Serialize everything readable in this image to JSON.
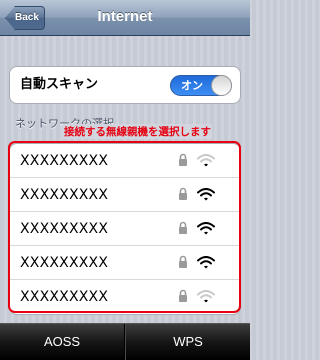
{
  "navbar": {
    "back_label": "Back",
    "title": "Internet"
  },
  "scan": {
    "label": "自動スキャン",
    "toggle_label": "オン",
    "toggle_on": true,
    "accent": "#2a7ae8"
  },
  "section_header": "ネットワークの選択",
  "annotation": {
    "text": "接続する無線親機を選択します",
    "color": "#e60012"
  },
  "networks": [
    {
      "name": "XXXXXXXXX",
      "locked": true,
      "signal": 1
    },
    {
      "name": "XXXXXXXXX",
      "locked": true,
      "signal": 3
    },
    {
      "name": "XXXXXXXXX",
      "locked": true,
      "signal": 3
    },
    {
      "name": "XXXXXXXXX",
      "locked": true,
      "signal": 3
    },
    {
      "name": "XXXXXXXXX",
      "locked": true,
      "signal": 1
    }
  ],
  "tabbar": {
    "aoss_label": "AOSS",
    "wps_label": "WPS"
  }
}
